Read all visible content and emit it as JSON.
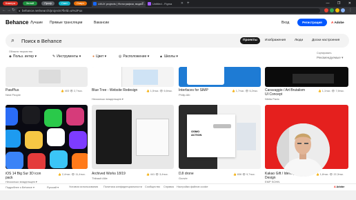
{
  "browser": {
    "tab_groups": [
      {
        "label": "Камера",
        "color": "#d93025"
      },
      {
        "label": "Зелий",
        "color": "#1e8e3e"
      },
      {
        "label": "Проф",
        "color": "#5f6368"
      },
      {
        "label": "Свет",
        "color": "#12b5cb"
      },
      {
        "label": "Озвуч",
        "color": "#e8710a"
      }
    ],
    "tabs": [
      {
        "title": "UI/UX projects | Фотографии, видео...",
        "active": true,
        "favicon_color": "#1769ff"
      },
      {
        "title": "Untitled - Figma",
        "active": false,
        "favicon_color": "#a259ff"
      }
    ],
    "new_tab_symbol": "+",
    "window_controls": "— ❐ ✕",
    "url": "behance.net/search/projects?field=ui%2Fux",
    "ext_colors": [
      "#ea4335",
      "#34a853",
      "#fbbc04",
      "#8ab4f8"
    ]
  },
  "header": {
    "logo": "Behance",
    "nav": [
      "Лучшие",
      "Прямые трансляции",
      "Вакансии"
    ],
    "sign_in": "Вход",
    "register": "Регистрация",
    "adobe_mark": "A",
    "adobe": "Adobe"
  },
  "search": {
    "placeholder": "Поиск в Behance",
    "tabs": [
      "Проекты",
      "Изображения",
      "Люди",
      "Доски настроения"
    ],
    "selected_tab": "Проекты"
  },
  "filters": {
    "field_label": "Области творчества",
    "field_value": "Польз. интер",
    "items": [
      {
        "label": "Инструменты",
        "icon": "tools-icon"
      },
      {
        "label": "Цвет",
        "icon": "color-icon"
      },
      {
        "label": "Расположение",
        "icon": "location-icon"
      },
      {
        "label": "Школы",
        "icon": "school-icon"
      }
    ],
    "sort_label": "Сортировать",
    "sort_value": "Рекомендуемые"
  },
  "projects_row1": [
    {
      "title": "PawPlus",
      "owner": "Nest People",
      "likes": "403",
      "views": "2,7тыс."
    },
    {
      "title": "Blue Tree - Website Redesign",
      "owner": "Несколько владельцев",
      "likes": "1,5тыс.",
      "views": "6,6тыс."
    },
    {
      "title": "Interfaces for SIMP",
      "owner": "Philip Alb",
      "likes": "1,7тыс.",
      "views": "6,2тыс."
    },
    {
      "title": "Caravaggio / Art Brutalism UI Concept",
      "owner": "Nikita Pavic",
      "likes": "1,1тыс.",
      "views": "7,6тыс."
    }
  ],
  "projects_row2": [
    {
      "title": "iOS 14 Big Sur 3D icon pack",
      "owner": "Несколько владельцев",
      "likes": "2,4тыс.",
      "views": "11,4тыс."
    },
    {
      "title": "Archived Works 18/19",
      "owner": "Thibault Allie",
      "likes": "441",
      "views": "3,4тыс."
    },
    {
      "title": "DJI drone",
      "owner": "Goovie",
      "likes": "836",
      "views": "9,7тыс."
    },
    {
      "title": "Kakao Gift / Identity Design",
      "owner": "EMP SOHN",
      "likes": "1,8тыс.",
      "views": "22,3тыс."
    }
  ],
  "row2_art": {
    "drone_text": "OSMO ACTION"
  },
  "footer": {
    "links": [
      "Подробнее о Behance",
      "Русский",
      "Условия использования",
      "Политика конфиденциальности",
      "Сообщество",
      "Справка",
      "Настройки файлов cookie"
    ],
    "adobe": "Adobe"
  },
  "colors": {
    "accent": "#0057ff",
    "adobe_red": "#fa0f00",
    "kakao_red": "#e5201e",
    "drone_bg": "#f2f2f2"
  }
}
